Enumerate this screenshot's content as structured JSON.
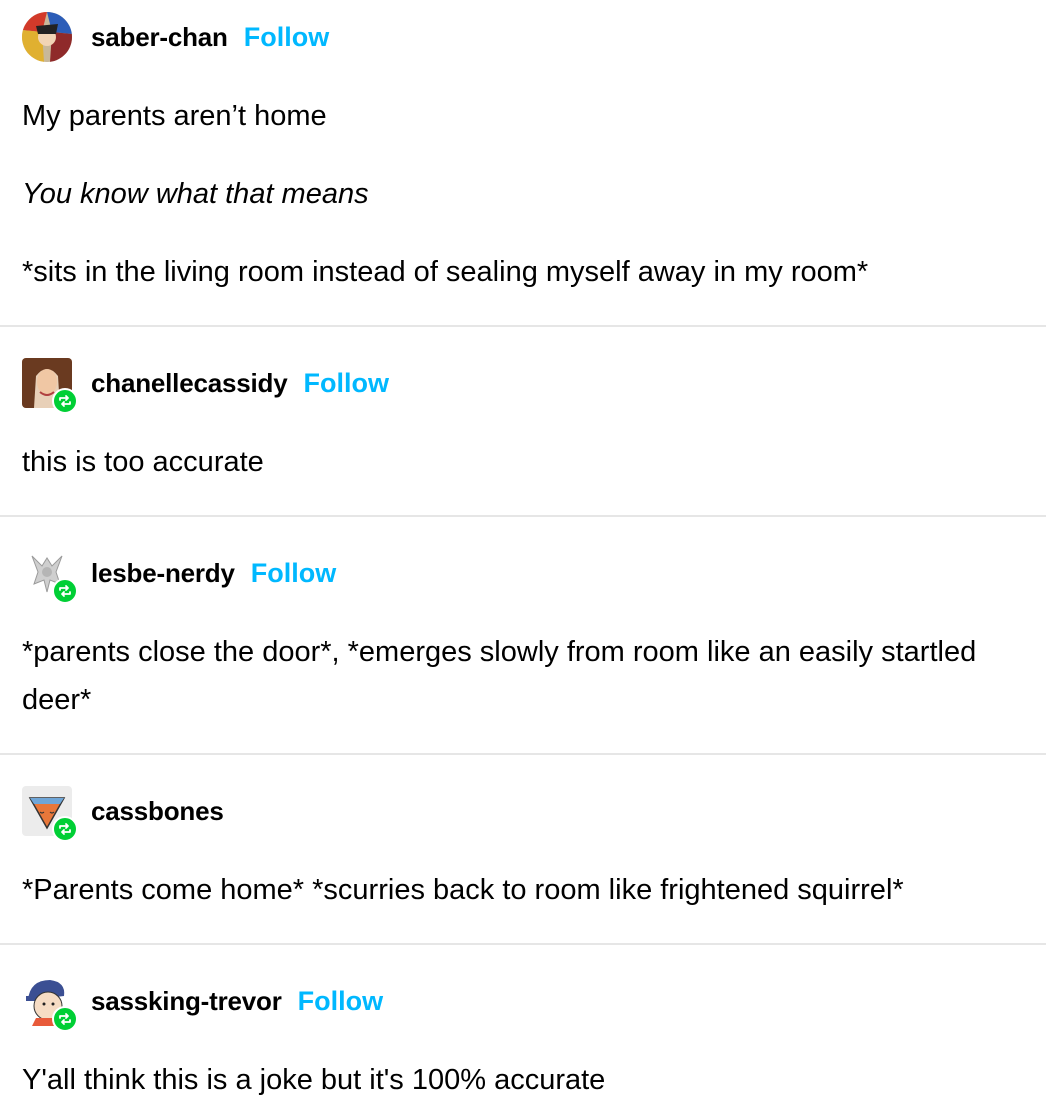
{
  "posts": [
    {
      "username": "saber-chan",
      "follow_label": "Follow",
      "is_reblog": false,
      "paragraphs": [
        "My parents aren’t home",
        "You know what that means",
        "*sits in the living room instead of sealing myself away in my room*"
      ]
    },
    {
      "username": "chanellecassidy",
      "follow_label": "Follow",
      "is_reblog": true,
      "paragraphs": [
        "this is too accurate"
      ]
    },
    {
      "username": "lesbe-nerdy",
      "follow_label": "Follow",
      "is_reblog": true,
      "paragraphs": [
        "*parents close the door*, *emerges slowly from room like an easily startled deer*"
      ]
    },
    {
      "username": "cassbones",
      "follow_label": "",
      "is_reblog": true,
      "paragraphs": [
        "*Parents come home* *scurries back to room like frightened squirrel*"
      ]
    },
    {
      "username": "sassking-trevor",
      "follow_label": "Follow",
      "is_reblog": true,
      "paragraphs": [
        "Y'all think this is a joke but it's 100% accurate"
      ]
    }
  ],
  "colors": {
    "follow": "#00b8ff",
    "reblog_badge": "#00cf35",
    "divider": "#e6e6e6"
  },
  "icons": {
    "reblog": "reblog-icon"
  }
}
